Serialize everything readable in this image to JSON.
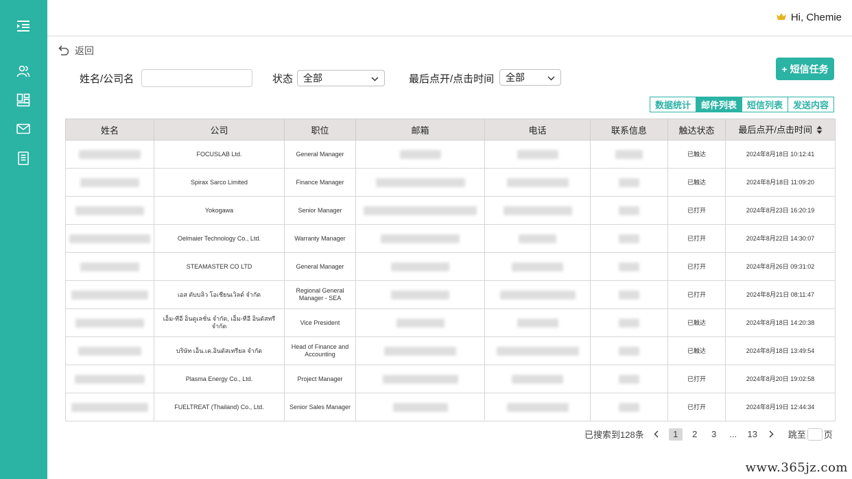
{
  "sidebar": {
    "icons": [
      "menu-indent-icon",
      "users-icon",
      "dashboard-icon",
      "mail-icon",
      "notebook-icon"
    ]
  },
  "header": {
    "greeting": "Hi, Chemie",
    "crown_color": "#e6b422"
  },
  "back": {
    "label": "返回"
  },
  "filters": {
    "name_label": "姓名/公司名",
    "name_value": "",
    "status_label": "状态",
    "status_value": "全部",
    "time_label": "最后点开/点击时间",
    "time_value": "全部"
  },
  "sms_task_button": {
    "label": "短信任务",
    "plus": "+"
  },
  "tabs": [
    {
      "label": "数据统计",
      "active": false
    },
    {
      "label": "邮件列表",
      "active": true
    },
    {
      "label": "短信列表",
      "active": false
    },
    {
      "label": "发送内容",
      "active": false
    }
  ],
  "table": {
    "columns": [
      "姓名",
      "公司",
      "职位",
      "邮箱",
      "电话",
      "联系信息",
      "触达状态",
      "最后点开/点击时间"
    ],
    "rows": [
      {
        "company": "FOCUSLAB Ltd.",
        "position": "General Manager",
        "status": "已触达",
        "time": "2024年8月18日 10:12:41"
      },
      {
        "company": "Spirax Sarco Limited",
        "position": "Finance Manager",
        "status": "已触达",
        "time": "2024年8月18日 11:09:20"
      },
      {
        "company": "Yokogawa",
        "position": "Senior Manager",
        "status": "已打开",
        "time": "2024年8月23日 16:20:19"
      },
      {
        "company": "Oelmaier Technology Co., Ltd.",
        "position": "Warranty Manager",
        "status": "已打开",
        "time": "2024年8月22日 14:30:07"
      },
      {
        "company": "STEAMASTER CO LTD",
        "position": "General Manager",
        "status": "已打开",
        "time": "2024年8月26日 09:31:02"
      },
      {
        "company": "เอส ดับบลิว โอเชียนเวิลด์ จำกัด",
        "position": "Regional General Manager - SEA",
        "status": "已打开",
        "time": "2024年8月21日 08:11:47"
      },
      {
        "company": "เอ็ม-ทีอี อินดูเลชั่น จำกัด, เอ็ม-ทีอี อินดัสทรี จำกัด",
        "position": "Vice President",
        "status": "已触达",
        "time": "2024年8月18日 14:20:38"
      },
      {
        "company": "บริษัท เอ็น.เค.อินดัสเทรียล จำกัด",
        "position": "Head of Finance and Accounting",
        "status": "已触达",
        "time": "2024年8月18日 13:49:54"
      },
      {
        "company": "Plasma Energy Co., Ltd.",
        "position": "Project Manager",
        "status": "已打开",
        "time": "2024年8月20日 19:02:58"
      },
      {
        "company": "FUELTREAT (Thailand) Co., Ltd.",
        "position": "Senior Sales Manager",
        "status": "已打开",
        "time": "2024年8月19日 12:44:34"
      }
    ]
  },
  "pagination": {
    "total_text": "已搜索到128条",
    "pages": [
      "1",
      "2",
      "3",
      "...",
      "13"
    ],
    "current": "1",
    "jump_label": "跳至",
    "page_suffix": "页"
  },
  "watermark": "www.365jz.com",
  "colors": {
    "accent": "#2bb3a4",
    "header_bg": "#e5e1e1"
  }
}
